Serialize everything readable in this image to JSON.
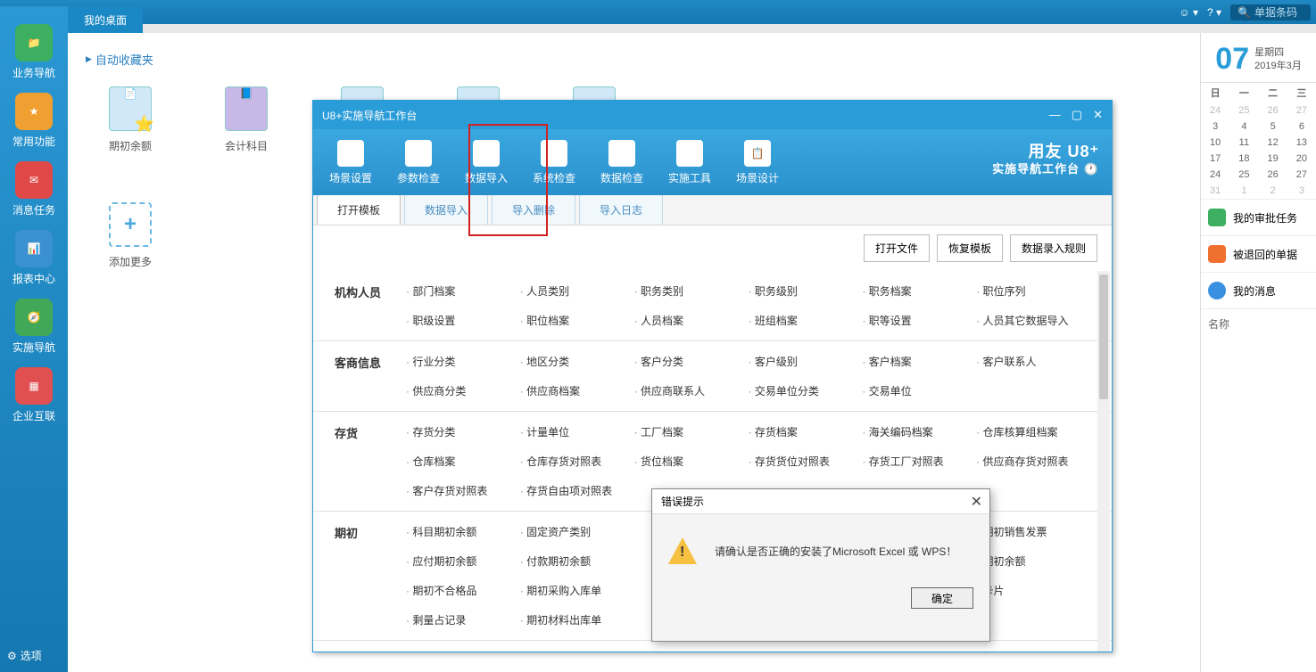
{
  "topbar": {
    "search_placeholder": "单据条码"
  },
  "leftNav": {
    "items": [
      "业务导航",
      "常用功能",
      "消息任务",
      "报表中心",
      "实施导航",
      "企业互联"
    ],
    "options": "选项"
  },
  "desktop": {
    "tab": "我的桌面",
    "autoFav": "自动收藏夹",
    "icons": {
      "a": "期初余额",
      "b": "会计科目",
      "add": "添加更多"
    }
  },
  "modal": {
    "title": "U8+实施导航工作台",
    "toolbar": [
      "场景设置",
      "参数检查",
      "数据导入",
      "系统检查",
      "数据检查",
      "实施工具",
      "场景设计"
    ],
    "brand1": "用友 U8⁺",
    "brand2": "实施导航工作台",
    "tabs": [
      "打开模板",
      "数据导入",
      "导入删除",
      "导入日志"
    ],
    "actions": [
      "打开文件",
      "恢复模板",
      "数据录入规则"
    ],
    "sections": [
      {
        "label": "机构人员",
        "links": [
          "部门档案",
          "人员类别",
          "职务类别",
          "职务级别",
          "职务档案",
          "职位序列",
          "职级设置",
          "职位档案",
          "人员档案",
          "班组档案",
          "职等设置",
          "人员其它数据导入"
        ]
      },
      {
        "label": "客商信息",
        "links": [
          "行业分类",
          "地区分类",
          "客户分类",
          "客户级别",
          "客户档案",
          "客户联系人",
          "供应商分类",
          "供应商档案",
          "供应商联系人",
          "交易单位分类",
          "交易单位",
          ""
        ]
      },
      {
        "label": "存货",
        "links": [
          "存货分类",
          "计量单位",
          "工厂档案",
          "存货档案",
          "海关编码档案",
          "仓库核算组档案",
          "仓库档案",
          "仓库存货对照表",
          "货位档案",
          "存货货位对照表",
          "存货工厂对照表",
          "供应商存货对照表",
          "客户存货对照表",
          "存货自由项对照表",
          "",
          "",
          "",
          ""
        ]
      },
      {
        "label": "期初",
        "links": [
          "科目期初余额",
          "固定资产类别",
          "",
          "",
          "",
          "期初销售发票",
          "应付期初余额",
          "付款期初余额",
          "",
          "",
          "",
          "期初余额",
          "期初不合格品",
          "期初采购入库单",
          "",
          "",
          "",
          "卡片",
          "剩量占记录",
          "期初材料出库单",
          "",
          "",
          "",
          ""
        ]
      }
    ]
  },
  "error": {
    "title": "错误提示",
    "msg": "请确认是否正确的安装了Microsoft Excel 或 WPS！",
    "ok": "确定"
  },
  "rightPane": {
    "dayBig": "07",
    "weekday": "星期四",
    "yearMonth": "2019年3月",
    "weekHdr": [
      "日",
      "一",
      "二",
      "三"
    ],
    "rows": [
      [
        "24",
        "25",
        "26",
        "27"
      ],
      [
        "3",
        "4",
        "5",
        "6"
      ],
      [
        "10",
        "11",
        "12",
        "13"
      ],
      [
        "17",
        "18",
        "19",
        "20"
      ],
      [
        "24",
        "25",
        "26",
        "27"
      ],
      [
        "31",
        "1",
        "2",
        "3"
      ]
    ],
    "msgs": [
      "我的审批任务",
      "被退回的单据",
      "我的消息"
    ],
    "field": "名称"
  }
}
